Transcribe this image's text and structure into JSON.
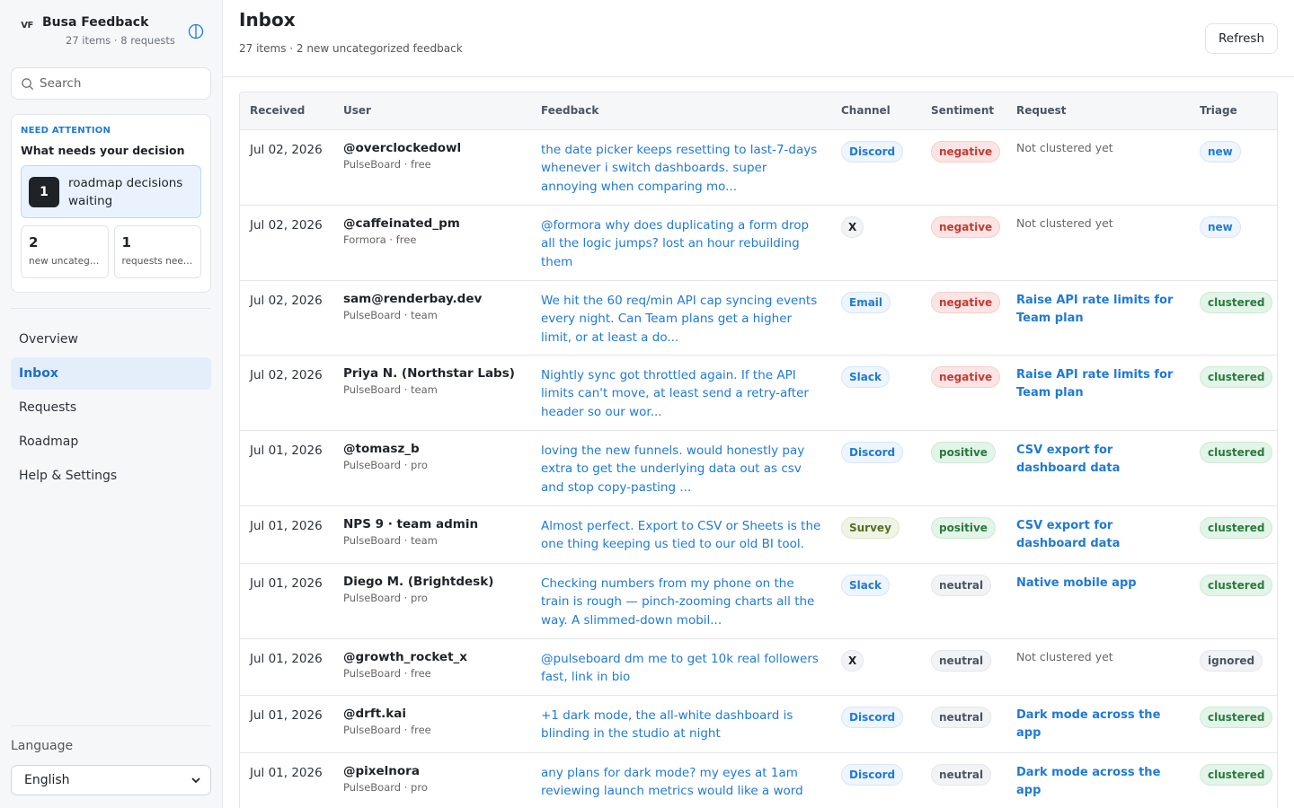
{
  "brand": {
    "logo": "VF",
    "name": "Busa Feedback",
    "subtitle": "27 items · 8 requests",
    "toggle_icon": "sidebar-toggle-icon"
  },
  "search": {
    "placeholder": "Search"
  },
  "attention": {
    "eyebrow": "NEED ATTENTION",
    "title": "What needs your decision",
    "main": {
      "count": "1",
      "label": "roadmap decisions waiting"
    },
    "cards": [
      {
        "count": "2",
        "label": "new uncategorized feedback"
      },
      {
        "count": "1",
        "label": "requests need review"
      }
    ]
  },
  "nav": {
    "items": [
      {
        "label": "Overview",
        "active": false
      },
      {
        "label": "Inbox",
        "active": true
      },
      {
        "label": "Requests",
        "active": false
      },
      {
        "label": "Roadmap",
        "active": false
      },
      {
        "label": "Help & Settings",
        "active": false
      }
    ]
  },
  "language": {
    "label": "Language",
    "value": "English"
  },
  "header": {
    "title": "Inbox",
    "subtitle": "27 items · 2 new uncategorized feedback",
    "refresh_label": "Refresh"
  },
  "table": {
    "columns": [
      "Received",
      "User",
      "Feedback",
      "Channel",
      "Sentiment",
      "Request",
      "Triage"
    ],
    "rows": [
      {
        "date": "Jul 02, 2026",
        "user": "@overclockedowl",
        "org": "PulseBoard · free",
        "feedback": "the date picker keeps resetting to last-7-days whenever i switch dashboards. super annoying when comparing mo...",
        "channel": "Discord",
        "sentiment": "negative",
        "request": "Not clustered yet",
        "request_clustered": false,
        "triage": "new"
      },
      {
        "date": "Jul 02, 2026",
        "user": "@caffeinated_pm",
        "org": "Formora · free",
        "feedback": "@formora why does duplicating a form drop all the logic jumps? lost an hour rebuilding them",
        "channel": "X",
        "sentiment": "negative",
        "request": "Not clustered yet",
        "request_clustered": false,
        "triage": "new"
      },
      {
        "date": "Jul 02, 2026",
        "user": "sam@renderbay.dev",
        "org": "PulseBoard · team",
        "feedback": "We hit the 60 req/min API cap syncing events every night. Can Team plans get a higher limit, or at least a do...",
        "channel": "Email",
        "sentiment": "negative",
        "request": "Raise API rate limits for Team plan",
        "request_clustered": true,
        "triage": "clustered"
      },
      {
        "date": "Jul 02, 2026",
        "user": "Priya N. (Northstar Labs)",
        "org": "PulseBoard · team",
        "feedback": "Nightly sync got throttled again. If the API limits can't move, at least send a retry-after header so our wor...",
        "channel": "Slack",
        "sentiment": "negative",
        "request": "Raise API rate limits for Team plan",
        "request_clustered": true,
        "triage": "clustered"
      },
      {
        "date": "Jul 01, 2026",
        "user": "@tomasz_b",
        "org": "PulseBoard · pro",
        "feedback": "loving the new funnels. would honestly pay extra to get the underlying data out as csv and stop copy-pasting ...",
        "channel": "Discord",
        "sentiment": "positive",
        "request": "CSV export for dashboard data",
        "request_clustered": true,
        "triage": "clustered"
      },
      {
        "date": "Jul 01, 2026",
        "user": "NPS 9 · team admin",
        "org": "PulseBoard · team",
        "feedback": "Almost perfect. Export to CSV or Sheets is the one thing keeping us tied to our old BI tool.",
        "channel": "Survey",
        "sentiment": "positive",
        "request": "CSV export for dashboard data",
        "request_clustered": true,
        "triage": "clustered"
      },
      {
        "date": "Jul 01, 2026",
        "user": "Diego M. (Brightdesk)",
        "org": "PulseBoard · pro",
        "feedback": "Checking numbers from my phone on the train is rough — pinch-zooming charts all the way. A slimmed-down mobil...",
        "channel": "Slack",
        "sentiment": "neutral",
        "request": "Native mobile app",
        "request_clustered": true,
        "triage": "clustered"
      },
      {
        "date": "Jul 01, 2026",
        "user": "@growth_rocket_x",
        "org": "PulseBoard · free",
        "feedback": "@pulseboard dm me to get 10k real followers fast, link in bio",
        "channel": "X",
        "sentiment": "neutral",
        "request": "Not clustered yet",
        "request_clustered": false,
        "triage": "ignored"
      },
      {
        "date": "Jul 01, 2026",
        "user": "@drft.kai",
        "org": "PulseBoard · free",
        "feedback": "+1 dark mode, the all-white dashboard is blinding in the studio at night",
        "channel": "Discord",
        "sentiment": "neutral",
        "request": "Dark mode across the app",
        "request_clustered": true,
        "triage": "clustered"
      },
      {
        "date": "Jul 01, 2026",
        "user": "@pixelnora",
        "org": "PulseBoard · pro",
        "feedback": "any plans for dark mode? my eyes at 1am reviewing launch metrics would like a word",
        "channel": "Discord",
        "sentiment": "neutral",
        "request": "Dark mode across the app",
        "request_clustered": true,
        "triage": "clustered"
      }
    ]
  }
}
